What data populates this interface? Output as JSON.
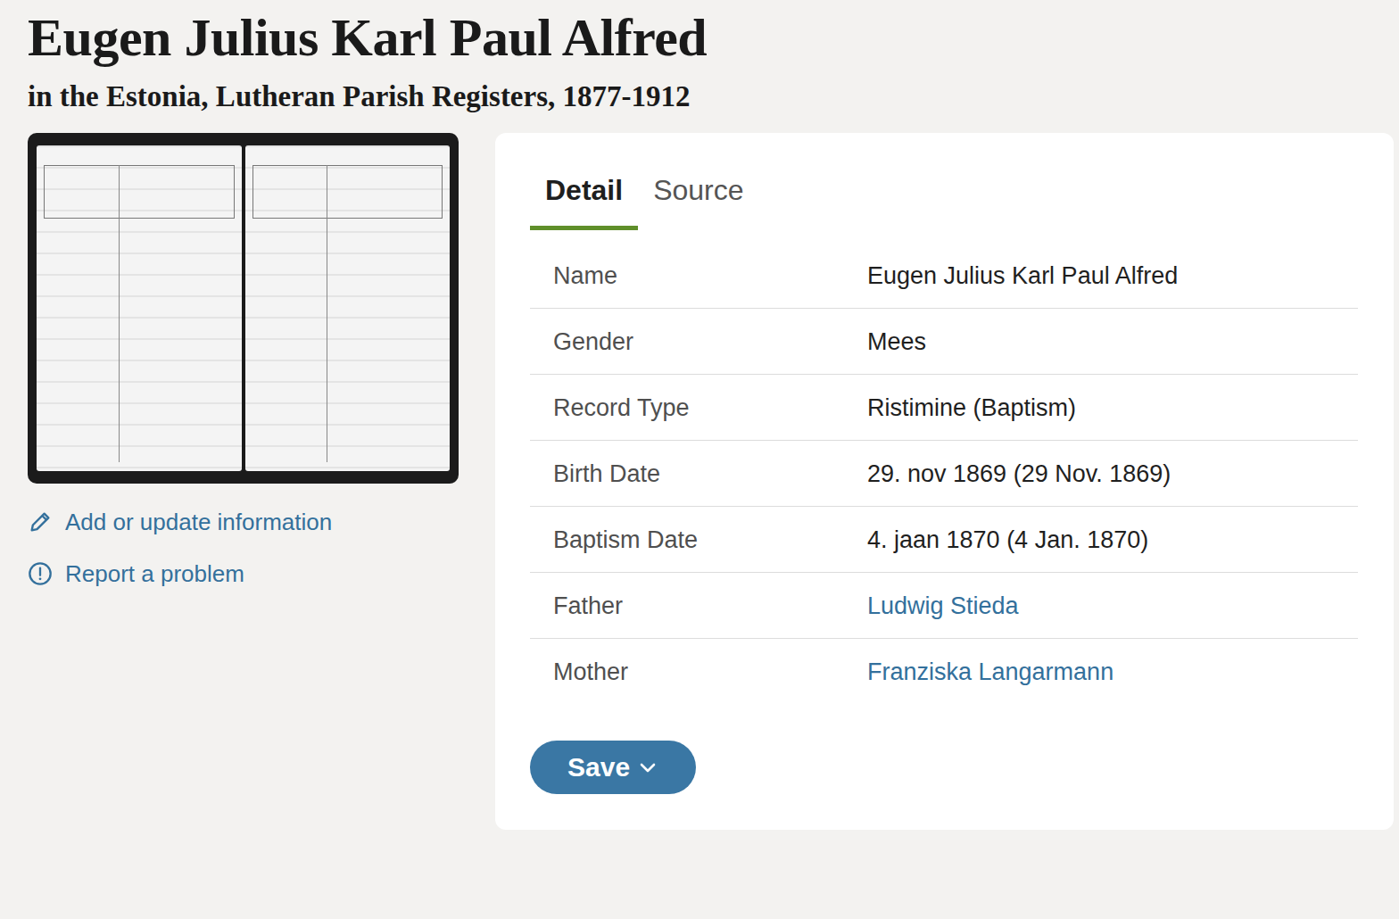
{
  "header": {
    "title": "Eugen Julius Karl Paul Alfred",
    "subtitle": "in the Estonia, Lutheran Parish Registers, 1877-1912"
  },
  "actions": [
    {
      "label": "Add or update information"
    },
    {
      "label": "Report a problem"
    }
  ],
  "tabs": [
    {
      "label": "Detail",
      "selected": true
    },
    {
      "label": "Source",
      "selected": false
    }
  ],
  "details": [
    {
      "label": "Name",
      "value": "Eugen Julius Karl Paul Alfred",
      "kind": "text"
    },
    {
      "label": "Gender",
      "value": "Mees",
      "kind": "text"
    },
    {
      "label": "Record Type",
      "value": "Ristimine (Baptism)",
      "kind": "text"
    },
    {
      "label": "Birth Date",
      "value": "29. nov 1869 (29 Nov. 1869)",
      "kind": "text"
    },
    {
      "label": "Baptism Date",
      "value": "4. jaan 1870 (4 Jan. 1870)",
      "kind": "text"
    },
    {
      "label": "Father",
      "value": "Ludwig Stieda",
      "kind": "link"
    },
    {
      "label": "Mother",
      "value": "Franziska Langarmann",
      "kind": "link"
    }
  ],
  "save_button": {
    "label": "Save"
  }
}
